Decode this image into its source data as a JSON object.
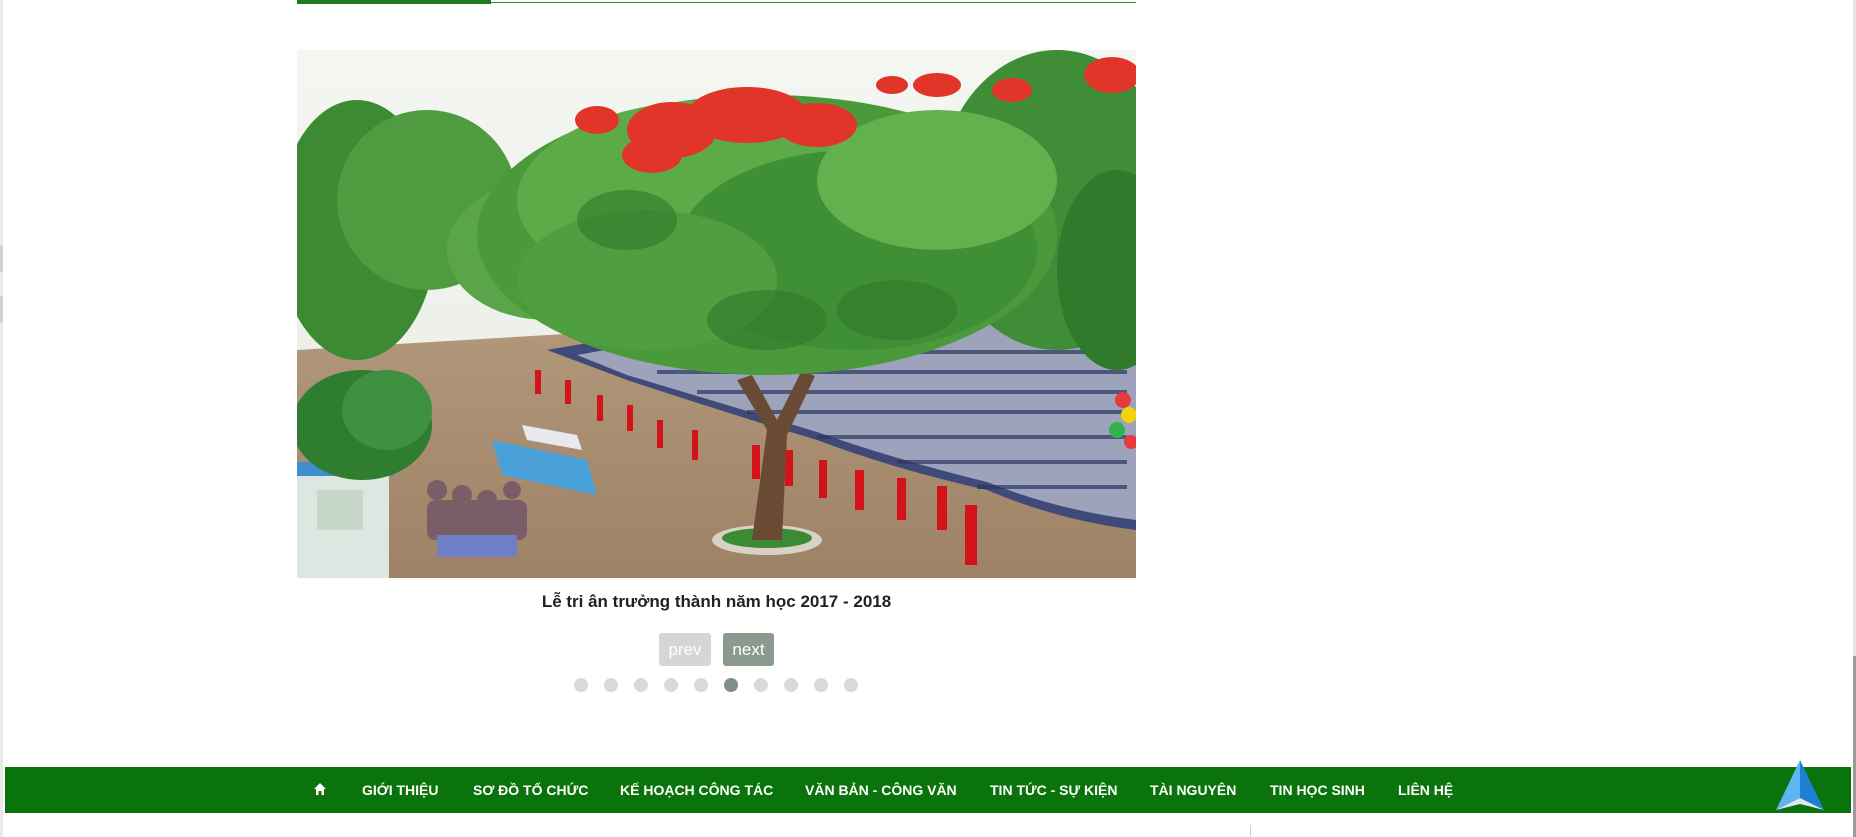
{
  "slider": {
    "caption": "Lễ tri ân trưởng thành năm học 2017 - 2018",
    "image_name": "school-ceremony-photo",
    "prev_label": "prev",
    "next_label": "next",
    "slide_count": 10,
    "active_slide": 6
  },
  "navbar": {
    "home_icon": "home-icon",
    "items": [
      {
        "label": "GIỚI THIỆU"
      },
      {
        "label": "SƠ ĐỒ TỔ CHỨC"
      },
      {
        "label": "KẾ HOẠCH CÔNG TÁC"
      },
      {
        "label": "VĂN BẢN - CÔNG VĂN"
      },
      {
        "label": "TIN TỨC - SỰ KIỆN"
      },
      {
        "label": "TÀI NGUYÊN"
      },
      {
        "label": "TIN HỌC SINH"
      },
      {
        "label": "LIÊN HỆ"
      }
    ]
  },
  "scroll_top_icon": "scroll-to-top-icon",
  "colors": {
    "brand_green": "#0b730b",
    "next_button": "#8a9a8e",
    "prev_button": "#d6d6d6",
    "dot": "#d9d9d9",
    "dot_active": "#7f8f84"
  }
}
